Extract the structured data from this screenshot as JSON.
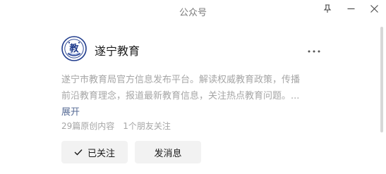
{
  "window": {
    "title": "公众号",
    "buttons": [
      "pin-icon",
      "minimize-icon",
      "close-icon"
    ]
  },
  "account": {
    "name": "遂宁教育",
    "avatar_char": "教",
    "description_lines": [
      "遂宁市教育局官方信息发布平台。解读权威教育政策，传播",
      "前沿教育理念，报道最新教育信息，关注热点教育问题。..."
    ],
    "expand_label": "展开",
    "original_count": "29篇原创内容",
    "friends_following": "1个朋友关注"
  },
  "actions": {
    "follow_label": "已关注",
    "message_label": "发消息"
  },
  "colors": {
    "link": "#576b95",
    "muted_text": "#a6a6a6",
    "button_bg": "#f2f2f2",
    "avatar_blue": "#1f3b8c"
  }
}
